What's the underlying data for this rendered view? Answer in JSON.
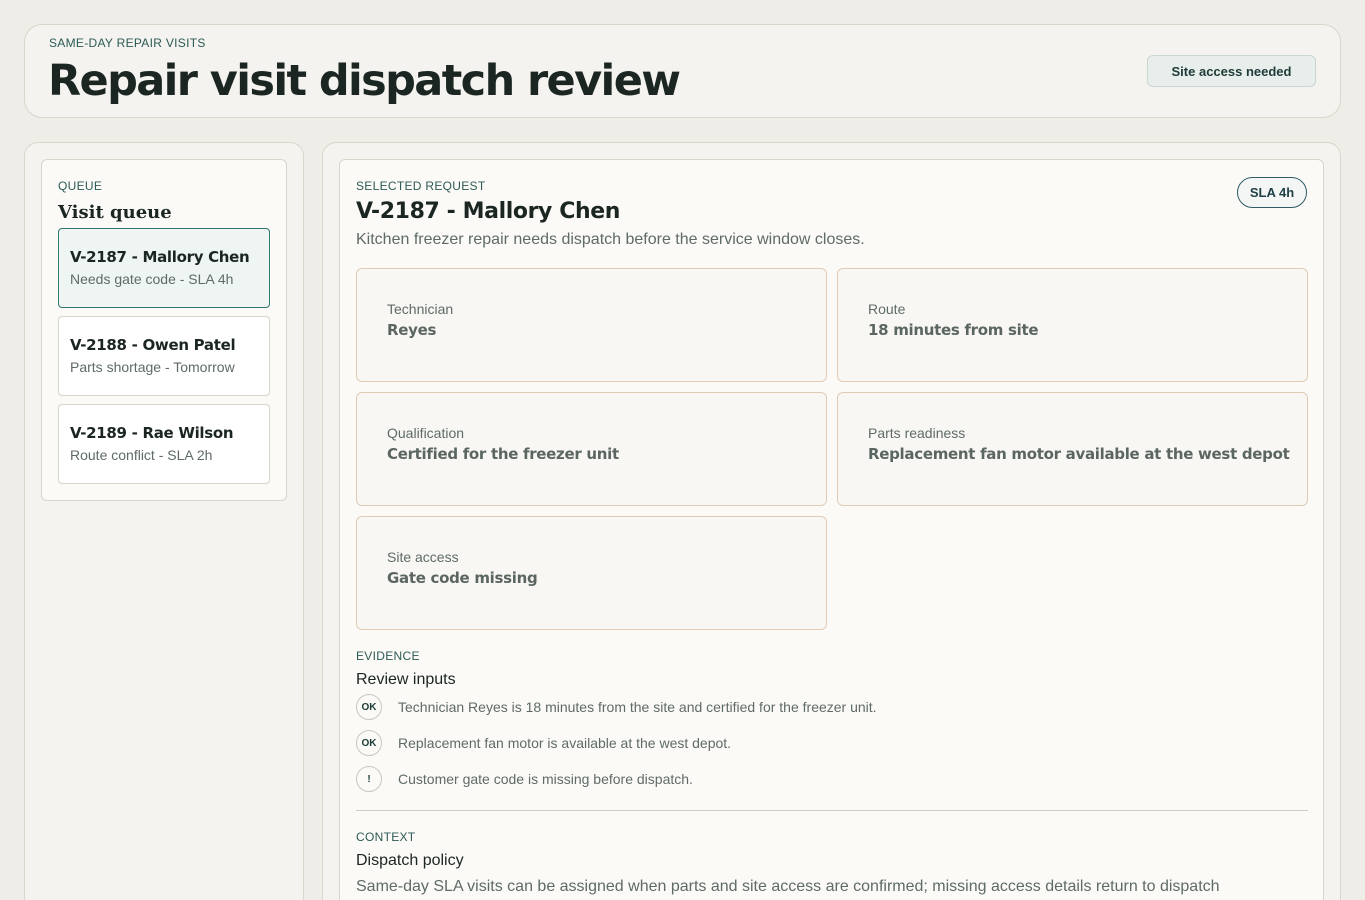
{
  "header": {
    "eyebrow": "SAME-DAY REPAIR VISITS",
    "title": "Repair visit dispatch review",
    "status_pill": "Site access needed"
  },
  "queue": {
    "eyebrow": "QUEUE",
    "title": "Visit queue",
    "items": [
      {
        "title": "V-2187 - Mallory Chen",
        "subtitle": "Needs gate code - SLA 4h",
        "active": true
      },
      {
        "title": "V-2188 - Owen Patel",
        "subtitle": "Parts shortage - Tomorrow",
        "active": false
      },
      {
        "title": "V-2189 - Rae Wilson",
        "subtitle": "Route conflict - SLA 2h",
        "active": false
      }
    ]
  },
  "request": {
    "eyebrow": "SELECTED REQUEST",
    "title": "V-2187 - Mallory Chen",
    "description": "Kitchen freezer repair needs dispatch before the service window closes.",
    "sla_badge": "SLA 4h",
    "facts": [
      {
        "label": "Technician",
        "value": "Reyes"
      },
      {
        "label": "Route",
        "value": "18 minutes from site"
      },
      {
        "label": "Qualification",
        "value": "Certified for the freezer unit"
      },
      {
        "label": "Parts readiness",
        "value": "Replacement fan motor available at the west depot"
      },
      {
        "label": "Site access",
        "value": "Gate code missing"
      }
    ]
  },
  "evidence": {
    "eyebrow": "EVIDENCE",
    "title": "Review inputs",
    "items": [
      {
        "mark": "OK",
        "icon": "check-badge-icon",
        "text": "Technician Reyes is 18 minutes from the site and certified for the freezer unit."
      },
      {
        "mark": "OK",
        "icon": "check-badge-icon",
        "text": "Replacement fan motor is available at the west depot."
      },
      {
        "mark": "!",
        "icon": "warning-badge-icon",
        "text": "Customer gate code is missing before dispatch."
      }
    ]
  },
  "context": {
    "eyebrow": "CONTEXT",
    "title": "Dispatch policy",
    "text": "Same-day SLA visits can be assigned when parts and site access are confirmed; missing access details return to dispatch"
  },
  "colors": {
    "accent": "#2e7a6f",
    "background": "#efede7",
    "panel": "#f4f3ef",
    "warning_border": "#e0ccb6"
  }
}
